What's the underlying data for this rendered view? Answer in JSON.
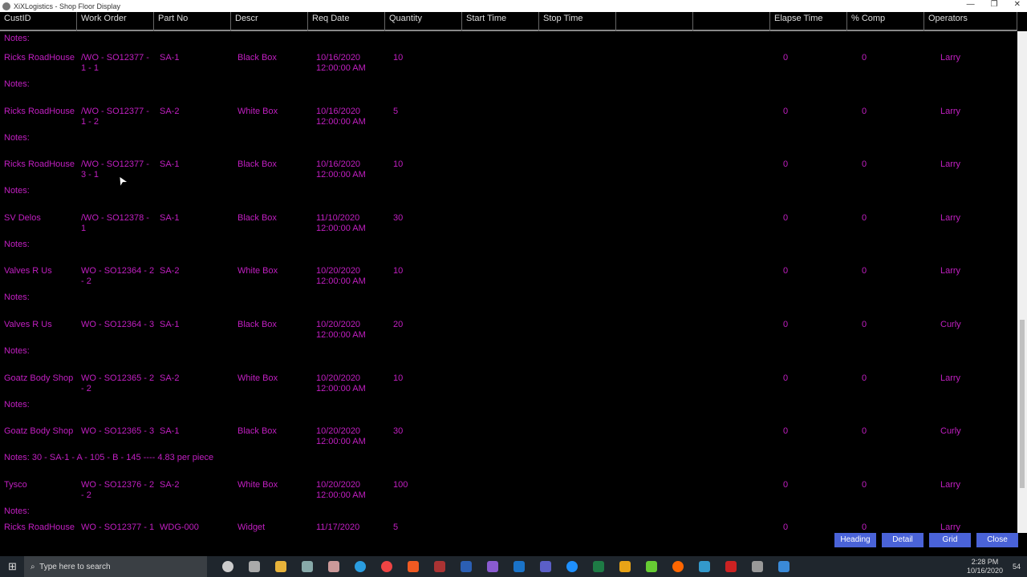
{
  "window": {
    "title": "XiXLogistics - Shop Floor Display"
  },
  "columns": [
    "CustID",
    "Work  Order",
    "Part No",
    "Descr",
    "Req Date",
    "Quantity",
    "Start Time",
    "Stop Time",
    "",
    "",
    "Elapse Time",
    "% Comp",
    "Operators"
  ],
  "top_notes": "Notes:",
  "rows": [
    {
      "cust": "Ricks RoadHouse",
      "wo": "/WO - SO12377 -",
      "wo2": "1 - 1",
      "part": "SA-1",
      "descr": "Black Box",
      "date": "10/16/2020",
      "time": "12:00:00 AM",
      "qty": "10",
      "elapse": "0",
      "comp": "0",
      "op": "Larry",
      "notes": "Notes:"
    },
    {
      "cust": "Ricks RoadHouse",
      "wo": "/WO - SO12377 -",
      "wo2": "1 - 2",
      "part": "SA-2",
      "descr": "White Box",
      "date": "10/16/2020",
      "time": "12:00:00 AM",
      "qty": "5",
      "elapse": "0",
      "comp": "0",
      "op": "Larry",
      "notes": "Notes:"
    },
    {
      "cust": "Ricks RoadHouse",
      "wo": "/WO - SO12377 -",
      "wo2": "3 - 1",
      "part": "SA-1",
      "descr": "Black Box",
      "date": "10/16/2020",
      "time": "12:00:00 AM",
      "qty": "10",
      "elapse": "0",
      "comp": "0",
      "op": "Larry",
      "notes": "Notes:"
    },
    {
      "cust": "SV Delos",
      "wo": "/WO - SO12378 -",
      "wo2": "1",
      "part": "SA-1",
      "descr": "Black Box",
      "date": "11/10/2020",
      "time": "12:00:00 AM",
      "qty": "30",
      "elapse": "0",
      "comp": "0",
      "op": "Larry",
      "notes": "Notes:"
    },
    {
      "cust": "Valves R Us",
      "wo": "WO - SO12364 - 2",
      "wo2": "- 2",
      "part": "SA-2",
      "descr": "White Box",
      "date": "10/20/2020",
      "time": "12:00:00 AM",
      "qty": "10",
      "elapse": "0",
      "comp": "0",
      "op": "Larry",
      "notes": "Notes:"
    },
    {
      "cust": "Valves R Us",
      "wo": "WO - SO12364 - 3",
      "wo2": "",
      "part": "SA-1",
      "descr": "Black Box",
      "date": "10/20/2020",
      "time": "12:00:00 AM",
      "qty": "20",
      "elapse": "0",
      "comp": "0",
      "op": "Curly",
      "notes": "Notes:"
    },
    {
      "cust": "Goatz Body Shop",
      "wo": "WO - SO12365 - 2",
      "wo2": "- 2",
      "part": "SA-2",
      "descr": "White Box",
      "date": "10/20/2020",
      "time": "12:00:00 AM",
      "qty": "10",
      "elapse": "0",
      "comp": "0",
      "op": "Larry",
      "notes": "Notes:"
    },
    {
      "cust": "Goatz Body Shop",
      "wo": "WO - SO12365 - 3",
      "wo2": "",
      "part": "SA-1",
      "descr": "Black Box",
      "date": "10/20/2020",
      "time": "12:00:00 AM",
      "qty": "30",
      "elapse": "0",
      "comp": "0",
      "op": "Curly",
      "notes": "Notes:  30 - SA-1 - A - 105 - B - 145 ---- 4.83 per piece"
    },
    {
      "cust": "Tysco",
      "wo": "WO - SO12376 - 2",
      "wo2": "- 2",
      "part": "SA-2",
      "descr": "White Box",
      "date": "10/20/2020",
      "time": "12:00:00 AM",
      "qty": "100",
      "elapse": "0",
      "comp": "0",
      "op": "Larry",
      "notes": "Notes:"
    },
    {
      "cust": "Ricks RoadHouse",
      "wo": "WO - SO12377 - 1",
      "wo2": "",
      "part": "WDG-000",
      "descr": "Widget",
      "date": "11/17/2020",
      "time": "",
      "qty": "5",
      "elapse": "0",
      "comp": "0",
      "op": "Larry",
      "notes": "Notes:"
    }
  ],
  "buttons": {
    "heading": "Heading",
    "detail": "Detail",
    "grid": "Grid",
    "close": "Close"
  },
  "button_color": "#4a63d8",
  "text_color": "#c21fc2",
  "taskbar": {
    "search_placeholder": "Type here to search",
    "time": "2:28 PM",
    "date": "10/16/2020",
    "notifications": "54"
  }
}
